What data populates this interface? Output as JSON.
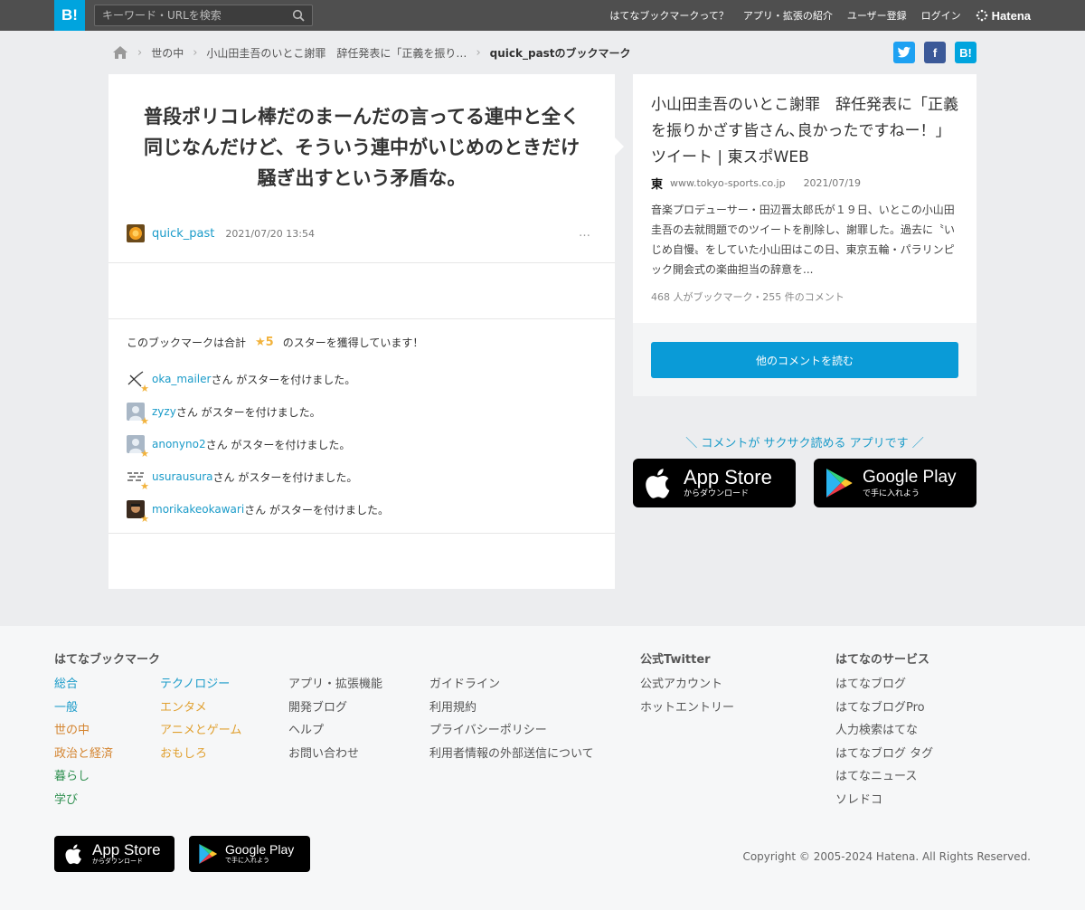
{
  "header": {
    "logo": "B!",
    "search_placeholder": "キーワード・URLを検索",
    "nav": [
      "はてなブックマークって？",
      "アプリ・拡張の紹介",
      "ユーザー登録",
      "ログイン"
    ],
    "brand": "Hatena"
  },
  "breadcrumb": {
    "items": [
      "世の中",
      "小山田圭吾のいとこ謝罪　辞任発表に「正義を振り…"
    ],
    "current": "quick_pastのブックマーク"
  },
  "social": {
    "twitter": "",
    "facebook": "f",
    "hatena": "B!"
  },
  "bookmark": {
    "comment": "普段ポリコレ棒だのまーんだの言ってる連中と全く同じなんだけど、そういう連中がいじめのときだけ騒ぎ出すという矛盾な。",
    "user": "quick_past",
    "date": "2021/07/20 13:54",
    "more": "…",
    "stars_prefix": "このブックマークは合計",
    "stars_count": "★5",
    "stars_suffix": "のスターを獲得しています！",
    "star_suffix_text": "さん がスターを付けました。",
    "stars": [
      {
        "name": "oka_mailer"
      },
      {
        "name": "zyzy"
      },
      {
        "name": "anonyno2"
      },
      {
        "name": "usurausura"
      },
      {
        "name": "morikakeokawari"
      }
    ]
  },
  "entry": {
    "title": "小山田圭吾のいとこ謝罪　辞任発表に「正義を振りかざす皆さん､良かったですねー！」ツイート | 東スポWEB",
    "favicon": "東",
    "domain": "www.tokyo-sports.co.jp",
    "date": "2021/07/19",
    "summary": "音楽プロデューサー・田辺晋太郎氏が１９日、いとこの小山田圭吾の去就問題でのツイートを削除し、謝罪した。過去に〝いじめ自慢〟をしていた小山田はこの日、東京五輪・パラリンピック開会式の楽曲担当の辞意を...",
    "counts": "468 人がブックマーク・255 件のコメント",
    "read_button": "他のコメントを読む"
  },
  "app_promo": "＼ コメントが サクサク読める アプリです ／",
  "badges": {
    "appstore_big": "App Store",
    "appstore_small": "からダウンロード",
    "googleplay_big": "Google Play",
    "googleplay_small": "で手に入れよう"
  },
  "footer": {
    "col1_head": "はてなブックマーク",
    "categories_a": [
      {
        "label": "総合",
        "color": "#1a9bc9"
      },
      {
        "label": "一般",
        "color": "#1a9bc9"
      },
      {
        "label": "世の中",
        "color": "#d4842f"
      },
      {
        "label": "政治と経済",
        "color": "#d4842f"
      },
      {
        "label": "暮らし",
        "color": "#2e8f4f"
      },
      {
        "label": "学び",
        "color": "#2e8f4f"
      }
    ],
    "categories_b": [
      {
        "label": "テクノロジー",
        "color": "#1a9bc9"
      },
      {
        "label": "エンタメ",
        "color": "#e0a030"
      },
      {
        "label": "アニメとゲーム",
        "color": "#e0a030"
      },
      {
        "label": "おもしろ",
        "color": "#e0a030"
      }
    ],
    "links_c": [
      "アプリ・拡張機能",
      "開発ブログ",
      "ヘルプ",
      "お問い合わせ"
    ],
    "links_d": [
      "ガイドライン",
      "利用規約",
      "プライバシーポリシー",
      "利用者情報の外部送信について"
    ],
    "twitter_head": "公式Twitter",
    "twitter_links": [
      "公式アカウント",
      "ホットエントリー"
    ],
    "services_head": "はてなのサービス",
    "services": [
      "はてなブログ",
      "はてなブログPro",
      "人力検索はてな",
      "はてなブログ タグ",
      "はてなニュース",
      "ソレドコ"
    ],
    "copyright": "Copyright © 2005-2024 Hatena. All Rights Reserved."
  }
}
